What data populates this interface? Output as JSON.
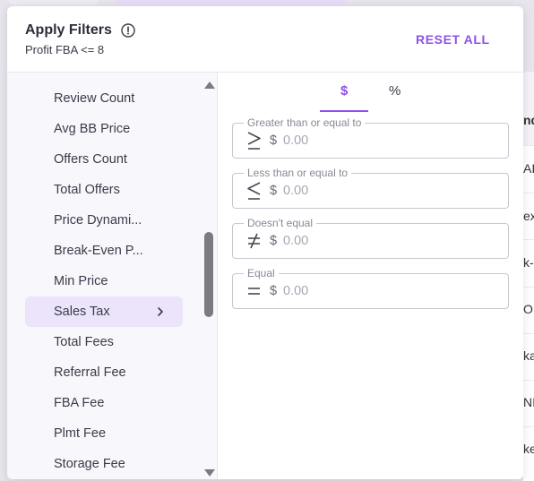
{
  "panel": {
    "title": "Apply Filters",
    "subtitle": "Profit FBA <= 8",
    "reset_label": "RESET ALL"
  },
  "sidebar": {
    "items": [
      {
        "label": "Review Count"
      },
      {
        "label": "Avg BB Price"
      },
      {
        "label": "Offers Count"
      },
      {
        "label": "Total Offers"
      },
      {
        "label": "Price Dynami..."
      },
      {
        "label": "Break-Even P..."
      },
      {
        "label": "Min Price"
      },
      {
        "label": "Sales Tax",
        "active": true
      },
      {
        "label": "Total Fees"
      },
      {
        "label": "Referral Fee"
      },
      {
        "label": "FBA Fee"
      },
      {
        "label": "Plmt Fee"
      },
      {
        "label": "Storage Fee"
      }
    ]
  },
  "tabs": {
    "dollar": "$",
    "percent": "%",
    "selected": "$"
  },
  "filters": [
    {
      "legend": "Greater than or equal to",
      "operator_icon": "greater-equal-icon",
      "currency": "$",
      "placeholder": "0.00",
      "value": ""
    },
    {
      "legend": "Less than or equal to",
      "operator_icon": "less-equal-icon",
      "currency": "$",
      "placeholder": "0.00",
      "value": ""
    },
    {
      "legend": "Doesn't equal",
      "operator_icon": "not-equal-icon",
      "currency": "$",
      "placeholder": "0.00",
      "value": ""
    },
    {
      "legend": "Equal",
      "operator_icon": "equal-icon",
      "currency": "$",
      "placeholder": "0.00",
      "value": ""
    }
  ],
  "background_table": {
    "fragments": [
      "nd",
      "AI",
      "ex",
      "k-",
      "OF",
      "ka",
      "NI",
      "ke"
    ]
  },
  "colors": {
    "accent": "#8f52e6",
    "active_item_bg": "#ebe4fa",
    "sidebar_bg": "#f8f7fb"
  }
}
